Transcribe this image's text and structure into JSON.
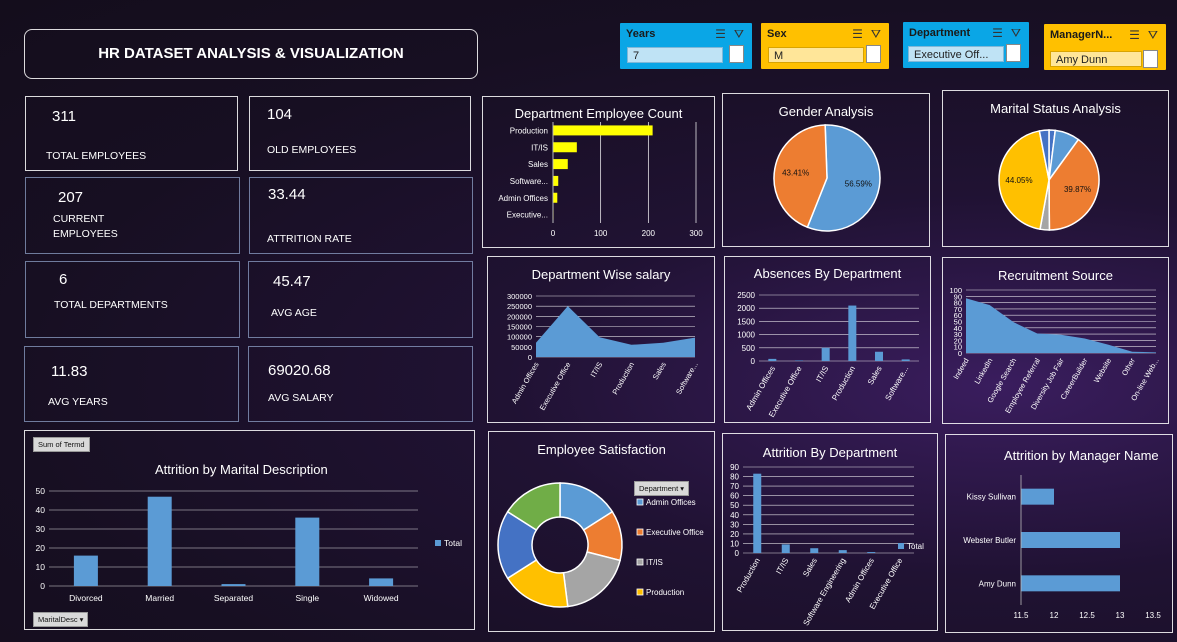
{
  "header": {
    "title": "HR DATASET ANALYSIS & VISUALIZATION"
  },
  "slicers": [
    {
      "title": "Years",
      "value": "7",
      "color": "#0aa6e6"
    },
    {
      "title": "Sex",
      "value": "M",
      "color": "#ffc000"
    },
    {
      "title": "Department",
      "value": "Executive Off...",
      "color": "#0aa6e6"
    },
    {
      "title": "ManagerN...",
      "value": "Amy Dunn",
      "color": "#ffc000"
    }
  ],
  "kpis": [
    {
      "value": "311",
      "label": "TOTAL EMPLOYEES"
    },
    {
      "value": "104",
      "label": "OLD EMPLOYEES"
    },
    {
      "value": "207",
      "label": "CURRENT EMPLOYEES"
    },
    {
      "value": "33.44",
      "label": "ATTRITION RATE"
    },
    {
      "value": "6",
      "label": "TOTAL DEPARTMENTS"
    },
    {
      "value": "45.47",
      "label": "AVG AGE"
    },
    {
      "value": "11.83",
      "label": "AVG YEARS"
    },
    {
      "value": "69020.68",
      "label": "AVG SALARY"
    }
  ],
  "colors": {
    "blue": "#5b9bd5",
    "orange": "#ed7d31",
    "gray": "#a5a5a5",
    "yellow": "#ffc000",
    "darkblue": "#4472c4",
    "green": "#70ad47",
    "bar_yellow": "#ffff00"
  },
  "chart_data": [
    {
      "id": "dept_count",
      "type": "bar",
      "orientation": "horizontal",
      "title": "Department Employee Count",
      "categories": [
        "Production",
        "IT/IS",
        "Sales",
        "Software...",
        "Admin Offices",
        "Executive..."
      ],
      "values": [
        209,
        50,
        31,
        11,
        9,
        1
      ],
      "xlim": [
        0,
        300
      ],
      "xticks": [
        "0",
        "100",
        "200",
        "300"
      ]
    },
    {
      "id": "gender",
      "type": "pie",
      "title": "Gender Analysis",
      "slices": [
        {
          "value": 56.59,
          "label": "56.59%",
          "color": "#5b9bd5"
        },
        {
          "value": 43.41,
          "label": "43.41%",
          "color": "#ed7d31"
        }
      ]
    },
    {
      "id": "marital",
      "type": "pie",
      "title": "Marital Status Analysis",
      "slices": [
        {
          "value": 2.0,
          "label": "",
          "color": "#4472c4"
        },
        {
          "value": 8.0,
          "label": "",
          "color": "#5b9bd5"
        },
        {
          "value": 39.87,
          "label": "39.87%",
          "color": "#ed7d31"
        },
        {
          "value": 3.0,
          "label": "",
          "color": "#a5a5a5"
        },
        {
          "value": 44.05,
          "label": "44.05%",
          "color": "#ffc000"
        },
        {
          "value": 3.08,
          "label": "",
          "color": "#4472c4"
        }
      ]
    },
    {
      "id": "dept_salary",
      "type": "area",
      "title": "Department Wise salary",
      "categories": [
        "Admin Offices",
        "Executive Office",
        "IT/IS",
        "Production",
        "Sales",
        "Software..."
      ],
      "values": [
        70000,
        250000,
        97000,
        60000,
        70000,
        95000
      ],
      "ylim": [
        0,
        300000
      ],
      "yticks": [
        "0",
        "50000",
        "100000",
        "150000",
        "200000",
        "250000",
        "300000"
      ]
    },
    {
      "id": "absences",
      "type": "bar",
      "title": "Absences By Department",
      "categories": [
        "Admin Offices",
        "Executive Office",
        "IT/IS",
        "Production",
        "Sales",
        "Software..."
      ],
      "values": [
        80,
        20,
        500,
        2100,
        350,
        60
      ],
      "ylim": [
        0,
        2500
      ],
      "yticks": [
        "0",
        "500",
        "1000",
        "1500",
        "2000",
        "2500"
      ]
    },
    {
      "id": "recruitment",
      "type": "area",
      "title": "Recruitment Source",
      "categories": [
        "Indeed",
        "LinkedIn",
        "Google Search",
        "Employee Referral",
        "Diversity Job Fair",
        "CareerBuilder",
        "Website",
        "Other",
        "On-line Web..."
      ],
      "values": [
        87,
        76,
        49,
        31,
        29,
        23,
        13,
        2,
        1
      ],
      "ylim": [
        0,
        100
      ],
      "yticks": [
        "0",
        "10",
        "20",
        "30",
        "40",
        "50",
        "60",
        "70",
        "80",
        "90",
        "100"
      ]
    },
    {
      "id": "attr_marital",
      "type": "bar",
      "title": "Attrition by Marital Description",
      "categories": [
        "Divorced",
        "Married",
        "Separated",
        "Single",
        "Widowed"
      ],
      "values": [
        16,
        47,
        1,
        36,
        4
      ],
      "ylim": [
        0,
        50
      ],
      "yticks": [
        "0",
        "10",
        "20",
        "30",
        "40",
        "50"
      ],
      "legend": "Total",
      "field_button": "Sum of Termd",
      "axis_button": "MaritalDesc"
    },
    {
      "id": "satisfaction",
      "type": "pie",
      "donut": true,
      "title": "Employee Satisfaction",
      "slices": [
        {
          "value": 16,
          "label": "",
          "color": "#5b9bd5"
        },
        {
          "value": 13,
          "label": "",
          "color": "#ed7d31"
        },
        {
          "value": 19,
          "label": "",
          "color": "#a5a5a5"
        },
        {
          "value": 18,
          "label": "",
          "color": "#ffc000"
        },
        {
          "value": 18,
          "label": "",
          "color": "#4472c4"
        },
        {
          "value": 16,
          "label": "",
          "color": "#70ad47"
        }
      ],
      "legend_header": "Department",
      "legend": [
        "Admin Offices",
        "Executive Office",
        "IT/IS",
        "Production"
      ]
    },
    {
      "id": "attr_dept",
      "type": "bar",
      "title": "Attrition By Department",
      "categories": [
        "Production",
        "IT/IS",
        "Sales",
        "Software Engineering",
        "Admin Offices",
        "Executive Office"
      ],
      "values": [
        83,
        9,
        5,
        3,
        1,
        0
      ],
      "ylim": [
        0,
        90
      ],
      "yticks": [
        "0",
        "10",
        "20",
        "30",
        "40",
        "50",
        "60",
        "70",
        "80",
        "90"
      ],
      "legend": "Total"
    },
    {
      "id": "attr_manager",
      "type": "bar",
      "orientation": "horizontal",
      "title": "Attrition by Manager Name",
      "categories": [
        "Kissy Sullivan",
        "Webster Butler",
        "Amy Dunn"
      ],
      "values": [
        12,
        13,
        13
      ],
      "xlim": [
        11.5,
        13.5
      ],
      "xticks": [
        "11.5",
        "12",
        "12.5",
        "13",
        "13.5"
      ]
    }
  ]
}
